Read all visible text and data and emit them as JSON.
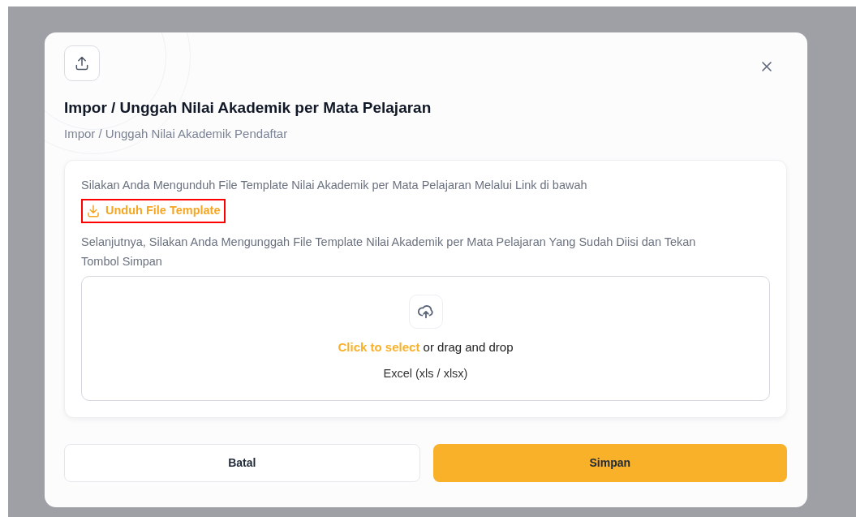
{
  "dialog": {
    "title": "Impor / Unggah Nilai Akademik per Mata Pelajaran",
    "subtitle": "Impor / Unggah Nilai Akademik Pendaftar",
    "instruction_1": "Silakan Anda Mengunduh File Template Nilai Akademik per Mata Pelajaran Melalui Link di bawah",
    "download_link": {
      "label": "Unduh File Template",
      "highlighted": true
    },
    "instruction_2": "Selanjutnya, Silakan Anda Mengunggah File Template Nilai Akademik per Mata Pelajaran Yang Sudah Diisi dan Tekan Tombol Simpan",
    "dropzone": {
      "select_label": "Click to select",
      "rest_label": "or drag and drop",
      "file_types": "Excel (xls / xlsx)"
    },
    "buttons": [
      {
        "label": "Batal",
        "kind": "secondary"
      },
      {
        "label": "Simpan",
        "kind": "primary"
      }
    ]
  }
}
